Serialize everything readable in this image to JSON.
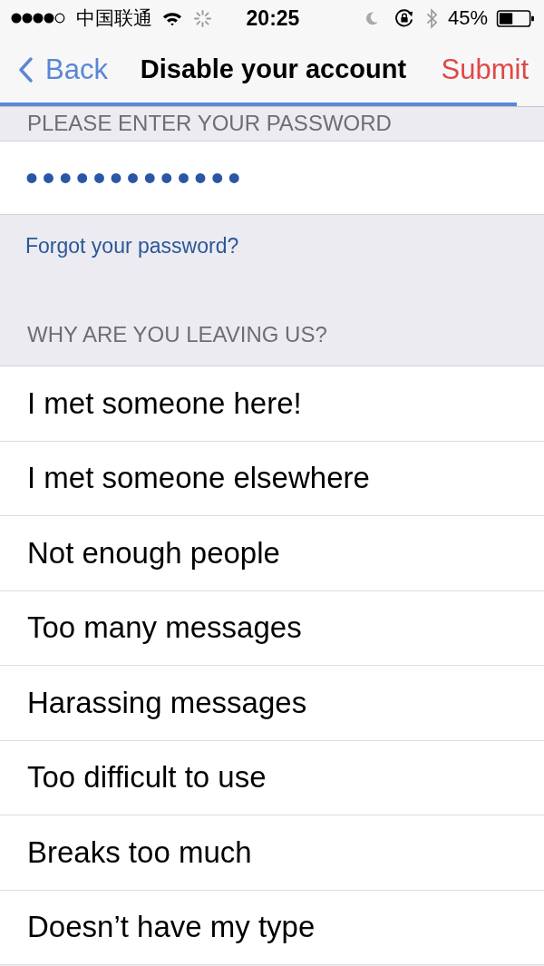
{
  "status_bar": {
    "carrier": "中国联通",
    "time": "20:25",
    "battery": "45%"
  },
  "nav": {
    "back": "Back",
    "title": "Disable your account",
    "action": "Submit",
    "progress": {
      "level": 0.95
    }
  },
  "password_section": {
    "header": "PLEASE ENTER YOUR PASSWORD",
    "value": "•••••••••••••",
    "link": "Forgot your password?"
  },
  "reasons": {
    "header": "WHY ARE YOU LEAVING US?",
    "items": [
      {
        "label": "I met someone here!",
        "selected": false
      },
      {
        "label": "I met someone elsewhere",
        "selected": false
      },
      {
        "label": "Not enough people",
        "selected": false
      },
      {
        "label": "Too many messages",
        "selected": false
      },
      {
        "label": "Harassing messages",
        "selected": false
      },
      {
        "label": "Too difficult to use",
        "selected": false
      },
      {
        "label": "Breaks too much",
        "selected": false
      },
      {
        "label": "Doesn’t have my type",
        "selected": false
      }
    ]
  }
}
